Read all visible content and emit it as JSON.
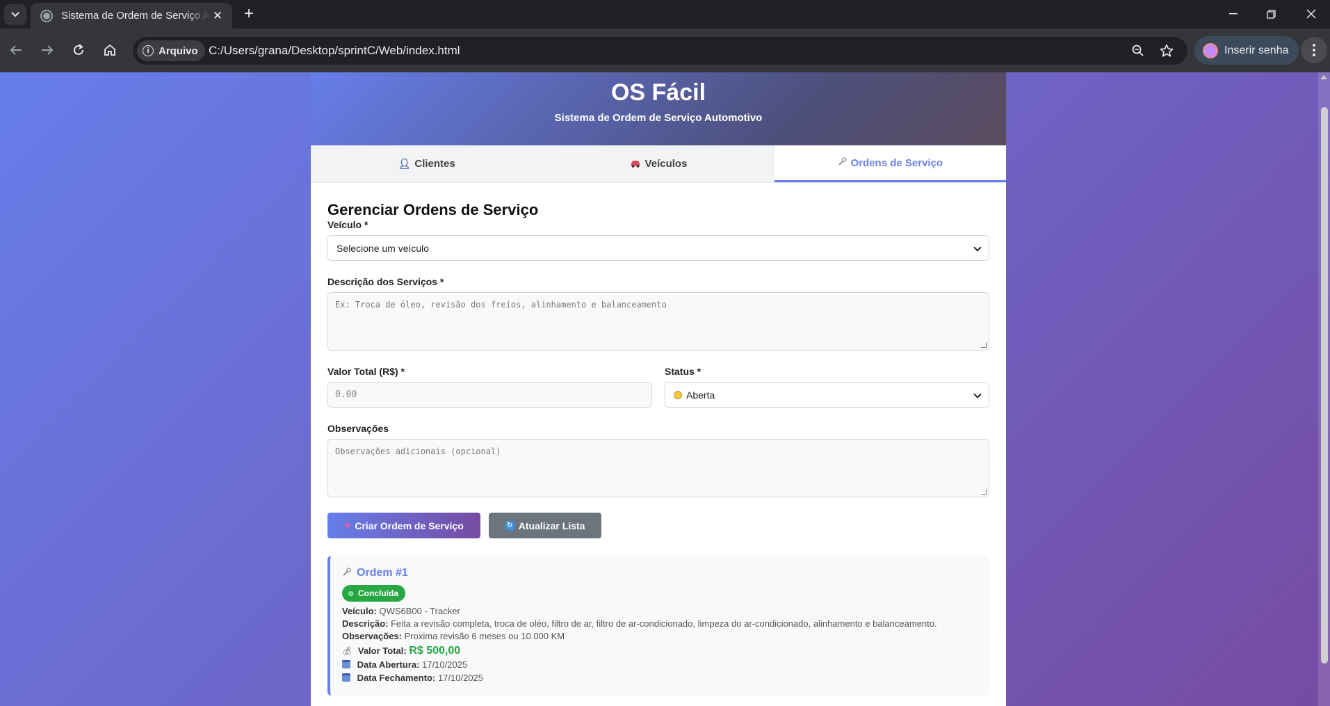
{
  "browser": {
    "tab_title": "Sistema de Ordem de Serviço Automotivo",
    "chip_label": "Arquivo",
    "url": "C:/Users/grana/Desktop/sprintC/Web/index.html",
    "profile_label": "Inserir senha"
  },
  "header": {
    "title": "OS Fácil",
    "subtitle": "Sistema de Ordem de Serviço Automotivo"
  },
  "tabs": [
    {
      "label": "Clientes",
      "icon": "person-icon"
    },
    {
      "label": "Veículos",
      "icon": "car-icon"
    },
    {
      "label": "Ordens de Serviço",
      "icon": "wrench-icon",
      "active": true
    }
  ],
  "form": {
    "section_title": "Gerenciar Ordens de Serviço",
    "vehicle_label": "Veículo *",
    "vehicle_value": "Selecione um veículo",
    "description_label": "Descrição dos Serviços *",
    "description_placeholder": "Ex: Troca de óleo, revisão dos freios, alinhamento e balanceamento",
    "total_label": "Valor Total (R$) *",
    "total_placeholder": "0.00",
    "status_label": "Status *",
    "status_value": "Aberta",
    "notes_label": "Observações",
    "notes_placeholder": "Observações adicionais (opcional)",
    "create_button": "Criar Ordem de Serviço",
    "refresh_button": "Atualizar Lista"
  },
  "orders": [
    {
      "title": "Ordem #1",
      "status": "Concluída",
      "vehicle_label": "Veículo:",
      "vehicle": "QWS6B00 - Tracker",
      "description_label": "Descrição:",
      "description": "Feita a revisão completa, troca de oléo, filtro de ar, filtro de ar-condicionado, limpeza do ar-condicionado, alinhamento e balanceamento.",
      "notes_label": "Observações:",
      "notes": "Proxima revisão 6 meses ou 10.000 KM",
      "total_label": "Valor Total:",
      "total": "R$ 500,00",
      "opened_label": "Data Abertura:",
      "opened": "17/10/2025",
      "closed_label": "Data Fechamento:",
      "closed": "17/10/2025"
    }
  ],
  "colors": {
    "accent": "#667eea",
    "gradient_end": "#764ba2",
    "success": "#28a745",
    "secondary": "#6c757d"
  }
}
